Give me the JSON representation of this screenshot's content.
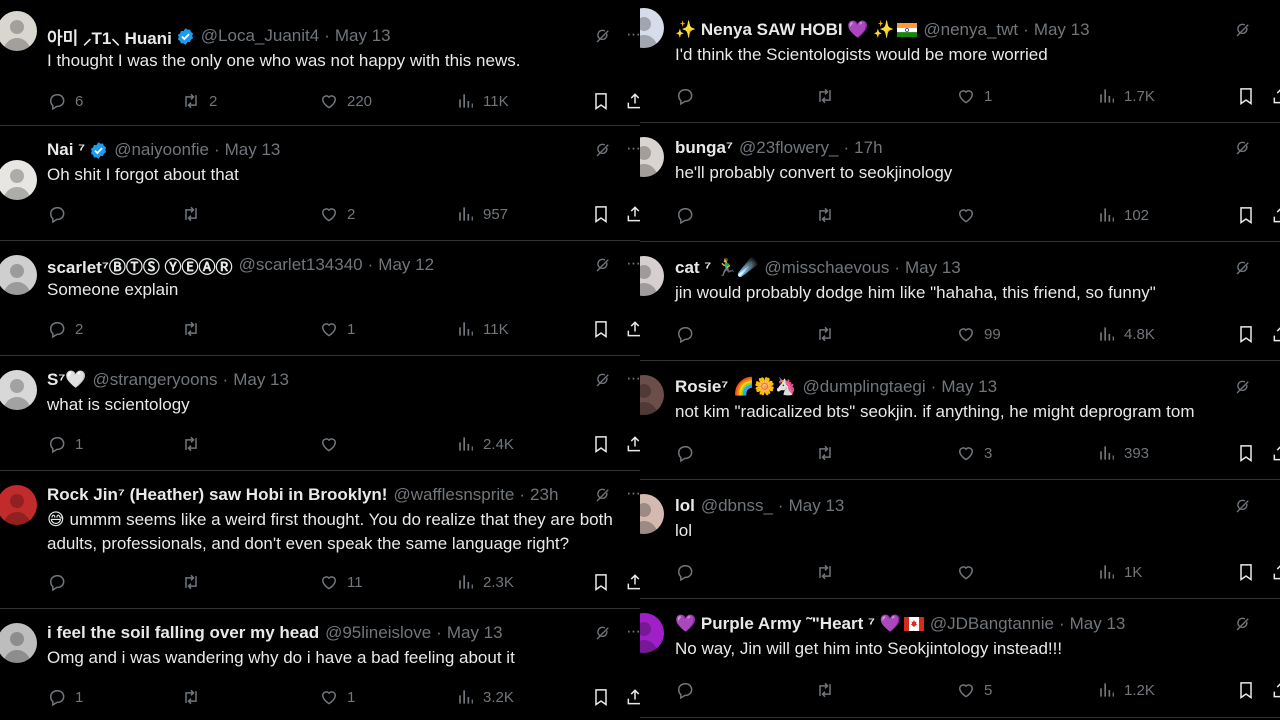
{
  "left": [
    {
      "name": "아미 ⸝T1⸜ Huani",
      "verified": true,
      "handle": "@Loca_Juanit4",
      "time": "May 13",
      "text": "I thought I was the only one who was not happy with this news.",
      "replies": "6",
      "retweets": "2",
      "likes": "220",
      "views": "11K",
      "avatar_color": "#d9d6cf"
    },
    {
      "name": "Nai ⁷",
      "verified": true,
      "handle": "@naiyoonfie",
      "time": "May 13",
      "text": "Oh shit I forgot about that",
      "replies": "",
      "retweets": "",
      "likes": "2",
      "views": "957",
      "avatar_color": "#e8e6e2"
    },
    {
      "name": "scarlet⁷ⒷⓉⓈ ⓎⒺⒶⓇ",
      "verified": false,
      "handle": "@scarlet134340",
      "time": "May 12",
      "text": "Someone explain",
      "replies": "2",
      "retweets": "",
      "likes": "1",
      "views": "11K",
      "avatar_color": "#cfcfcf"
    },
    {
      "name": "S⁷🤍",
      "verified": false,
      "handle": "@strangeryoons",
      "time": "May 13",
      "text": "what is scientology",
      "replies": "1",
      "retweets": "",
      "likes": "",
      "views": "2.4K",
      "avatar_color": "#d8d8d8"
    },
    {
      "name": "Rock Jin⁷ (Heather) saw Hobi in Brooklyn!",
      "verified": false,
      "handle": "@wafflesnsprite",
      "time": "23h",
      "text": "😅 ummm seems like a weird first thought. You do realize that they are both adults, professionals, and don't even speak the same language right?",
      "replies": "",
      "retweets": "",
      "likes": "11",
      "views": "2.3K",
      "avatar_color": "#c22b2b"
    },
    {
      "name": "i feel the soil falling over my head",
      "verified": false,
      "handle": "@95lineislove",
      "time": "May 13",
      "text": "Omg and i was wandering why do i have a bad feeling about it",
      "replies": "1",
      "retweets": "",
      "likes": "1",
      "views": "3.2K",
      "avatar_color": "#bdbdbd"
    }
  ],
  "right": [
    {
      "name": "✨ Nenya SAW HOBI 💜 ✨",
      "flag": "india",
      "verified": false,
      "handle": "@nenya_twt",
      "time": "May 13",
      "text": "I'd think the Scientologists would be more worried",
      "replies": "",
      "retweets": "",
      "likes": "1",
      "views": "1.7K",
      "avatar_color": "#d6dcea"
    },
    {
      "name": "bunga⁷",
      "verified": false,
      "handle": "@23flowery_",
      "time": "17h",
      "text": "he'll probably convert to seokjinology",
      "replies": "",
      "retweets": "",
      "likes": "",
      "views": "102",
      "avatar_color": "#d9d4cf"
    },
    {
      "name": "cat ⁷ 🏃‍♂️☄️",
      "verified": false,
      "handle": "@misschaevous",
      "time": "May 13",
      "text": "jin would probably dodge him like \"hahaha, this friend, so funny\"",
      "replies": "",
      "retweets": "",
      "likes": "99",
      "views": "4.8K",
      "avatar_color": "#d5cfd0"
    },
    {
      "name": "Rosie⁷ 🌈🌼🦄",
      "verified": false,
      "handle": "@dumplingtaegi",
      "time": "May 13",
      "text": "not kim \"radicalized bts\" seokjin. if anything, he might deprogram tom",
      "replies": "",
      "retweets": "",
      "likes": "3",
      "views": "393",
      "avatar_color": "#6b4d4a"
    },
    {
      "name": "lol",
      "verified": false,
      "handle": "@dbnss_",
      "time": "May 13",
      "text": "lol",
      "replies": "",
      "retweets": "",
      "likes": "",
      "views": "1K",
      "avatar_color": "#d3b9b0"
    },
    {
      "name": "💜 Purple Army ˜\"Heart ⁷ 💜",
      "flag": "canada",
      "verified": false,
      "handle": "@JDBangtannie",
      "time": "May 13",
      "text": "No way, Jin will get him into Seokjintology instead!!!",
      "replies": "",
      "retweets": "",
      "likes": "5",
      "views": "1.2K",
      "avatar_color": "#a020c8"
    }
  ],
  "icons": {
    "reply": "reply-icon",
    "retweet": "retweet-icon",
    "like": "heart-icon",
    "views": "views-icon",
    "bookmark": "bookmark-icon",
    "share": "share-icon",
    "grok": "grok-icon",
    "more": "more-icon",
    "verified": "verified-badge-icon"
  },
  "colors": {
    "background": "#000000",
    "text": "#e7e9ea",
    "muted": "#71767b",
    "divider": "#2f3336",
    "verified": "#1d9bf0"
  }
}
